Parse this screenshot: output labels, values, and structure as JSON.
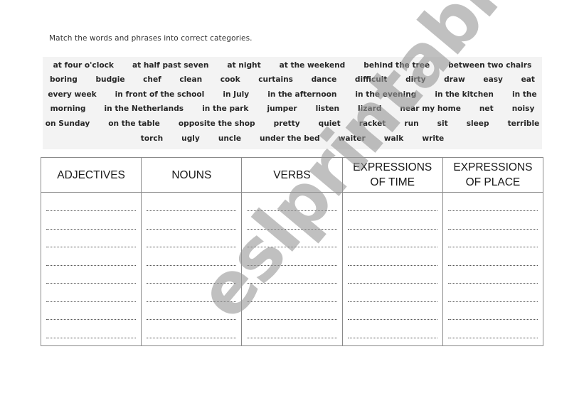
{
  "instruction": "Match the words and phrases into correct categories.",
  "word_bank": {
    "rows": [
      [
        "at four o'clock",
        "at half past seven",
        "at night",
        "at the weekend",
        "behind the tree",
        "between two chairs"
      ],
      [
        "boring",
        "budgie",
        "chef",
        "clean",
        "cook",
        "curtains",
        "dance",
        "difficult",
        "dirty",
        "draw",
        "easy",
        "eat"
      ],
      [
        "every week",
        "in front of the school",
        "in July",
        "in the afternoon",
        "in the evening",
        "in the kitchen",
        "in the"
      ],
      [
        "morning",
        "in the Netherlands",
        "in the park",
        "jumper",
        "listen",
        "lizard",
        "near my home",
        "net",
        "noisy"
      ],
      [
        "on Sunday",
        "on the table",
        "opposite the shop",
        "pretty",
        "quiet",
        "racket",
        "run",
        "sit",
        "sleep",
        "terrible"
      ],
      [
        "torch",
        "ugly",
        "uncle",
        "under the bed",
        "waiter",
        "walk",
        "write"
      ]
    ]
  },
  "table": {
    "columns": [
      {
        "header": "ADJECTIVES"
      },
      {
        "header": "NOUNS"
      },
      {
        "header": "VERBS"
      },
      {
        "header": "EXPRESSIONS OF TIME"
      },
      {
        "header": "EXPRESSIONS OF PLACE"
      }
    ],
    "answer_lines_per_column": 8
  },
  "watermark": {
    "text": "eslprintables.com"
  }
}
